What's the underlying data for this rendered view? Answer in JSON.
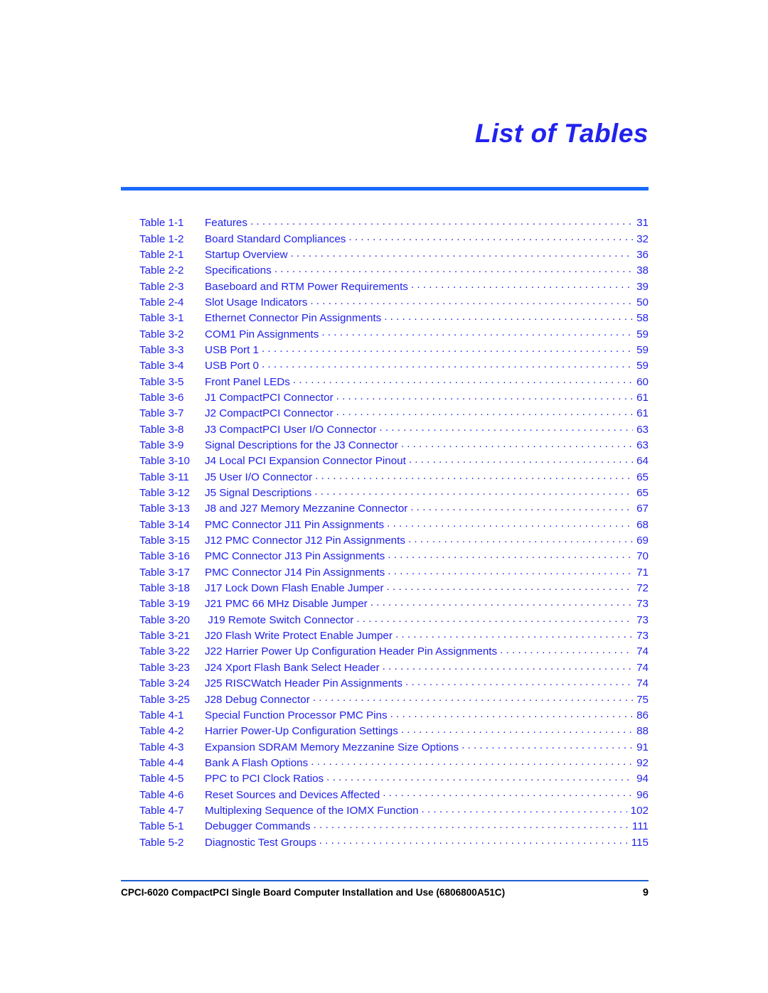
{
  "document": {
    "title": "List of Tables",
    "footer_text": "CPCI-6020 CompactPCI Single Board Computer Installation and Use (6806800A51C)",
    "footer_page_number": "9"
  },
  "colors": {
    "entry_blue": "#2222EE",
    "rule_blue": "#1A6AFF",
    "footer_rule_blue": "#1A5FD0",
    "footer_text": "#000000",
    "background": "#FFFFFF"
  },
  "toc": {
    "leader_character": ".",
    "entries": [
      {
        "label": "Table 1-1",
        "title": "Features",
        "page": "31"
      },
      {
        "label": "Table 1-2",
        "title": "Board Standard Compliances",
        "page": "32"
      },
      {
        "label": "Table 2-1",
        "title": "Startup Overview",
        "page": "36"
      },
      {
        "label": "Table 2-2",
        "title": "Specifications",
        "page": "38"
      },
      {
        "label": "Table 2-3",
        "title": "Baseboard and RTM Power Requirements",
        "page": "39"
      },
      {
        "label": "Table 2-4",
        "title": "Slot Usage Indicators",
        "page": "50"
      },
      {
        "label": "Table 3-1",
        "title": "Ethernet Connector Pin Assignments",
        "page": "58"
      },
      {
        "label": "Table 3-2",
        "title": "COM1 Pin Assignments",
        "page": "59"
      },
      {
        "label": "Table 3-3",
        "title": "USB Port 1",
        "page": "59"
      },
      {
        "label": "Table 3-4",
        "title": "USB Port 0",
        "page": "59"
      },
      {
        "label": "Table 3-5",
        "title": "Front Panel LEDs",
        "page": "60"
      },
      {
        "label": "Table 3-6",
        "title": "J1 CompactPCI Connector",
        "page": "61"
      },
      {
        "label": "Table 3-7",
        "title": "J2 CompactPCI Connector",
        "page": "61"
      },
      {
        "label": "Table 3-8",
        "title": "J3 CompactPCI User I/O Connector",
        "page": "63"
      },
      {
        "label": "Table 3-9",
        "title": "Signal Descriptions for the J3 Connector",
        "page": "63"
      },
      {
        "label": "Table 3-10",
        "title": "J4 Local PCI Expansion Connector Pinout",
        "page": "64"
      },
      {
        "label": "Table 3-11",
        "title": "J5 User I/O Connector",
        "page": "65"
      },
      {
        "label": "Table 3-12",
        "title": "J5 Signal Descriptions",
        "page": "65"
      },
      {
        "label": "Table 3-13",
        "title": "J8 and J27 Memory Mezzanine Connector",
        "page": "67"
      },
      {
        "label": "Table 3-14",
        "title": "PMC Connector J11 Pin Assignments",
        "page": "68"
      },
      {
        "label": "Table 3-15",
        "title": "J12 PMC Connector J12 Pin Assignments",
        "page": "69"
      },
      {
        "label": "Table 3-16",
        "title": "PMC Connector J13 Pin Assignments",
        "page": "70"
      },
      {
        "label": "Table 3-17",
        "title": "PMC Connector J14 Pin Assignments",
        "page": "71"
      },
      {
        "label": "Table 3-18",
        "title": "J17 Lock Down Flash Enable Jumper",
        "page": "72"
      },
      {
        "label": "Table 3-19",
        "title": "J21 PMC 66 MHz Disable Jumper",
        "page": "73"
      },
      {
        "label": "Table 3-20",
        "title": " J19 Remote Switch Connector",
        "page": "73"
      },
      {
        "label": "Table 3-21",
        "title": "J20 Flash Write Protect Enable Jumper",
        "page": "73"
      },
      {
        "label": "Table 3-22",
        "title": "J22 Harrier Power Up Configuration Header Pin Assignments",
        "page": "74"
      },
      {
        "label": "Table 3-23",
        "title": "J24 Xport Flash Bank Select Header",
        "page": "74"
      },
      {
        "label": "Table 3-24",
        "title": "J25 RISCWatch Header Pin Assignments",
        "page": "74"
      },
      {
        "label": "Table 3-25",
        "title": "J28 Debug Connector",
        "page": "75"
      },
      {
        "label": "Table 4-1",
        "title": "Special Function Processor PMC Pins",
        "page": "86"
      },
      {
        "label": "Table 4-2",
        "title": "Harrier Power-Up Configuration Settings",
        "page": "88"
      },
      {
        "label": "Table 4-3",
        "title": "Expansion SDRAM Memory Mezzanine Size Options",
        "page": "91"
      },
      {
        "label": "Table 4-4",
        "title": "Bank A Flash Options",
        "page": "92"
      },
      {
        "label": "Table 4-5",
        "title": "PPC to PCI Clock Ratios",
        "page": "94"
      },
      {
        "label": "Table 4-6",
        "title": "Reset Sources and Devices Affected",
        "page": "96"
      },
      {
        "label": "Table 4-7",
        "title": "Multiplexing Sequence of the IOMX Function",
        "page": "102"
      },
      {
        "label": "Table 5-1",
        "title": "Debugger Commands",
        "page": "111"
      },
      {
        "label": "Table 5-2",
        "title": "Diagnostic Test Groups",
        "page": "115"
      }
    ]
  }
}
